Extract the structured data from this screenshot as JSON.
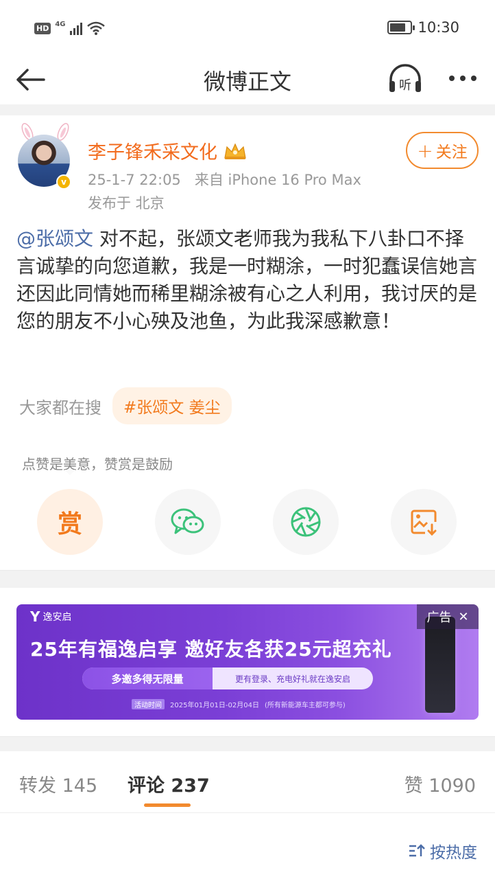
{
  "status_bar": {
    "hd": "HD",
    "network": "4G",
    "time": "10:30"
  },
  "nav": {
    "title": "微博正文"
  },
  "post": {
    "author": "李子锋禾采文化",
    "date": "25-1-7 22:05",
    "source": "来自 iPhone 16 Pro Max",
    "location": "发布于 北京",
    "follow_label": "关注",
    "mention": "@张颂文",
    "body": "对不起，张颂文老师我为我私下八卦口不择言诚挚的向您道歉，我是一时糊涂，一时犯蠢误信她言还因此同情她而稀里糊涂被有心之人利用，我讨厌的是您的朋友不小心殃及池鱼，为此我深感歉意！",
    "search_label": "大家都在搜",
    "topic": "#张颂文 姜尘",
    "reward_hint": "点赞是美意，赞赏是鼓励",
    "reward_label": "赏"
  },
  "ad": {
    "brand": "逸安启",
    "headline": "25年有福逸启享  邀好友各获25元超充礼",
    "pill_left": "多邀多得无限量",
    "pill_right": "更有登录、充电好礼就在逸安启",
    "date_tag": "活动时间",
    "date_range": "2025年01月01日-02月04日",
    "date_note": "(所有新能源车主都可参与)",
    "ad_label": "广告"
  },
  "tabs": {
    "repost": "转发 145",
    "comment": "评论 237",
    "like": "赞 1090"
  },
  "sort_label": "按热度",
  "colors": {
    "accent": "#f27a1d",
    "link": "#4c6da8",
    "wechat_green": "#3cc27a"
  }
}
